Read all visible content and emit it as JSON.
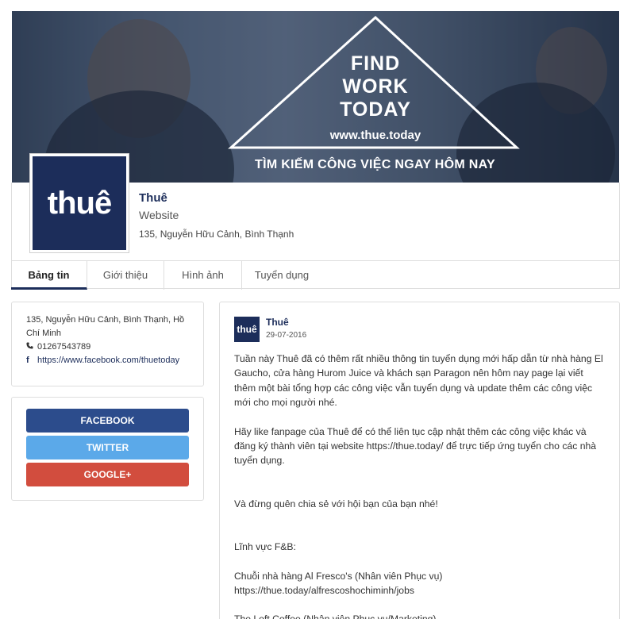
{
  "cover": {
    "headline_1": "FIND",
    "headline_2": "WORK",
    "headline_3": "TODAY",
    "url": "www.thue.today",
    "tagline": "TÌM KIẾM CÔNG VIỆC NGAY HÔM NAY"
  },
  "profile": {
    "logo_text": "thuê",
    "name": "Thuê",
    "type": "Website",
    "address": "135, Nguyễn Hữu Cảnh, Bình Thạnh"
  },
  "tabs": [
    "Bảng tin",
    "Giới thiệu",
    "Hình ảnh",
    "Tuyển dụng"
  ],
  "info": {
    "address": "135, Nguyễn Hữu Cảnh, Bình Thạnh, Hồ Chí Minh",
    "phone_icon": "phone-icon",
    "phone": "01267543789",
    "facebook_icon": "facebook-icon",
    "facebook_url": "https://www.facebook.com/thuetoday"
  },
  "share": {
    "facebook": "FACEBOOK",
    "twitter": "TWITTER",
    "google": "GOOGLE+"
  },
  "post": {
    "logo_text": "thuê",
    "author": "Thuê",
    "date": "29-07-2016",
    "paragraphs": [
      "Tuần này Thuê đã có thêm rất nhiều thông tin tuyển dụng mới hấp dẫn từ nhà hàng El Gaucho, cửa hàng Hurom Juice và khách sạn Paragon nên hôm nay page lại viết thêm một bài tổng hợp các công việc vẫn tuyển dụng và update thêm các công việc mới cho mọi người nhé.",
      "Hãy like fanpage của Thuê để có thể liên tục cập nhật thêm các công việc khác và đăng ký thành viên tại website https://thue.today/ để trực tiếp ứng tuyển cho các nhà tuyển dụng.",
      "Và đừng quên chia sẻ với hội bạn của bạn nhé!",
      "Lĩnh vực F&B:",
      "Chuỗi nhà hàng Al Fresco's (Nhân viên Phục vụ)",
      "https://thue.today/alfrescoshochiminh/jobs",
      "The Loft Coffee (Nhân viên Phục vụ/Marketing)"
    ]
  },
  "colors": {
    "brand": "#1c2d5a",
    "facebook": "#2c4c8c",
    "twitter": "#5ba9e9",
    "google": "#d24d3e"
  }
}
